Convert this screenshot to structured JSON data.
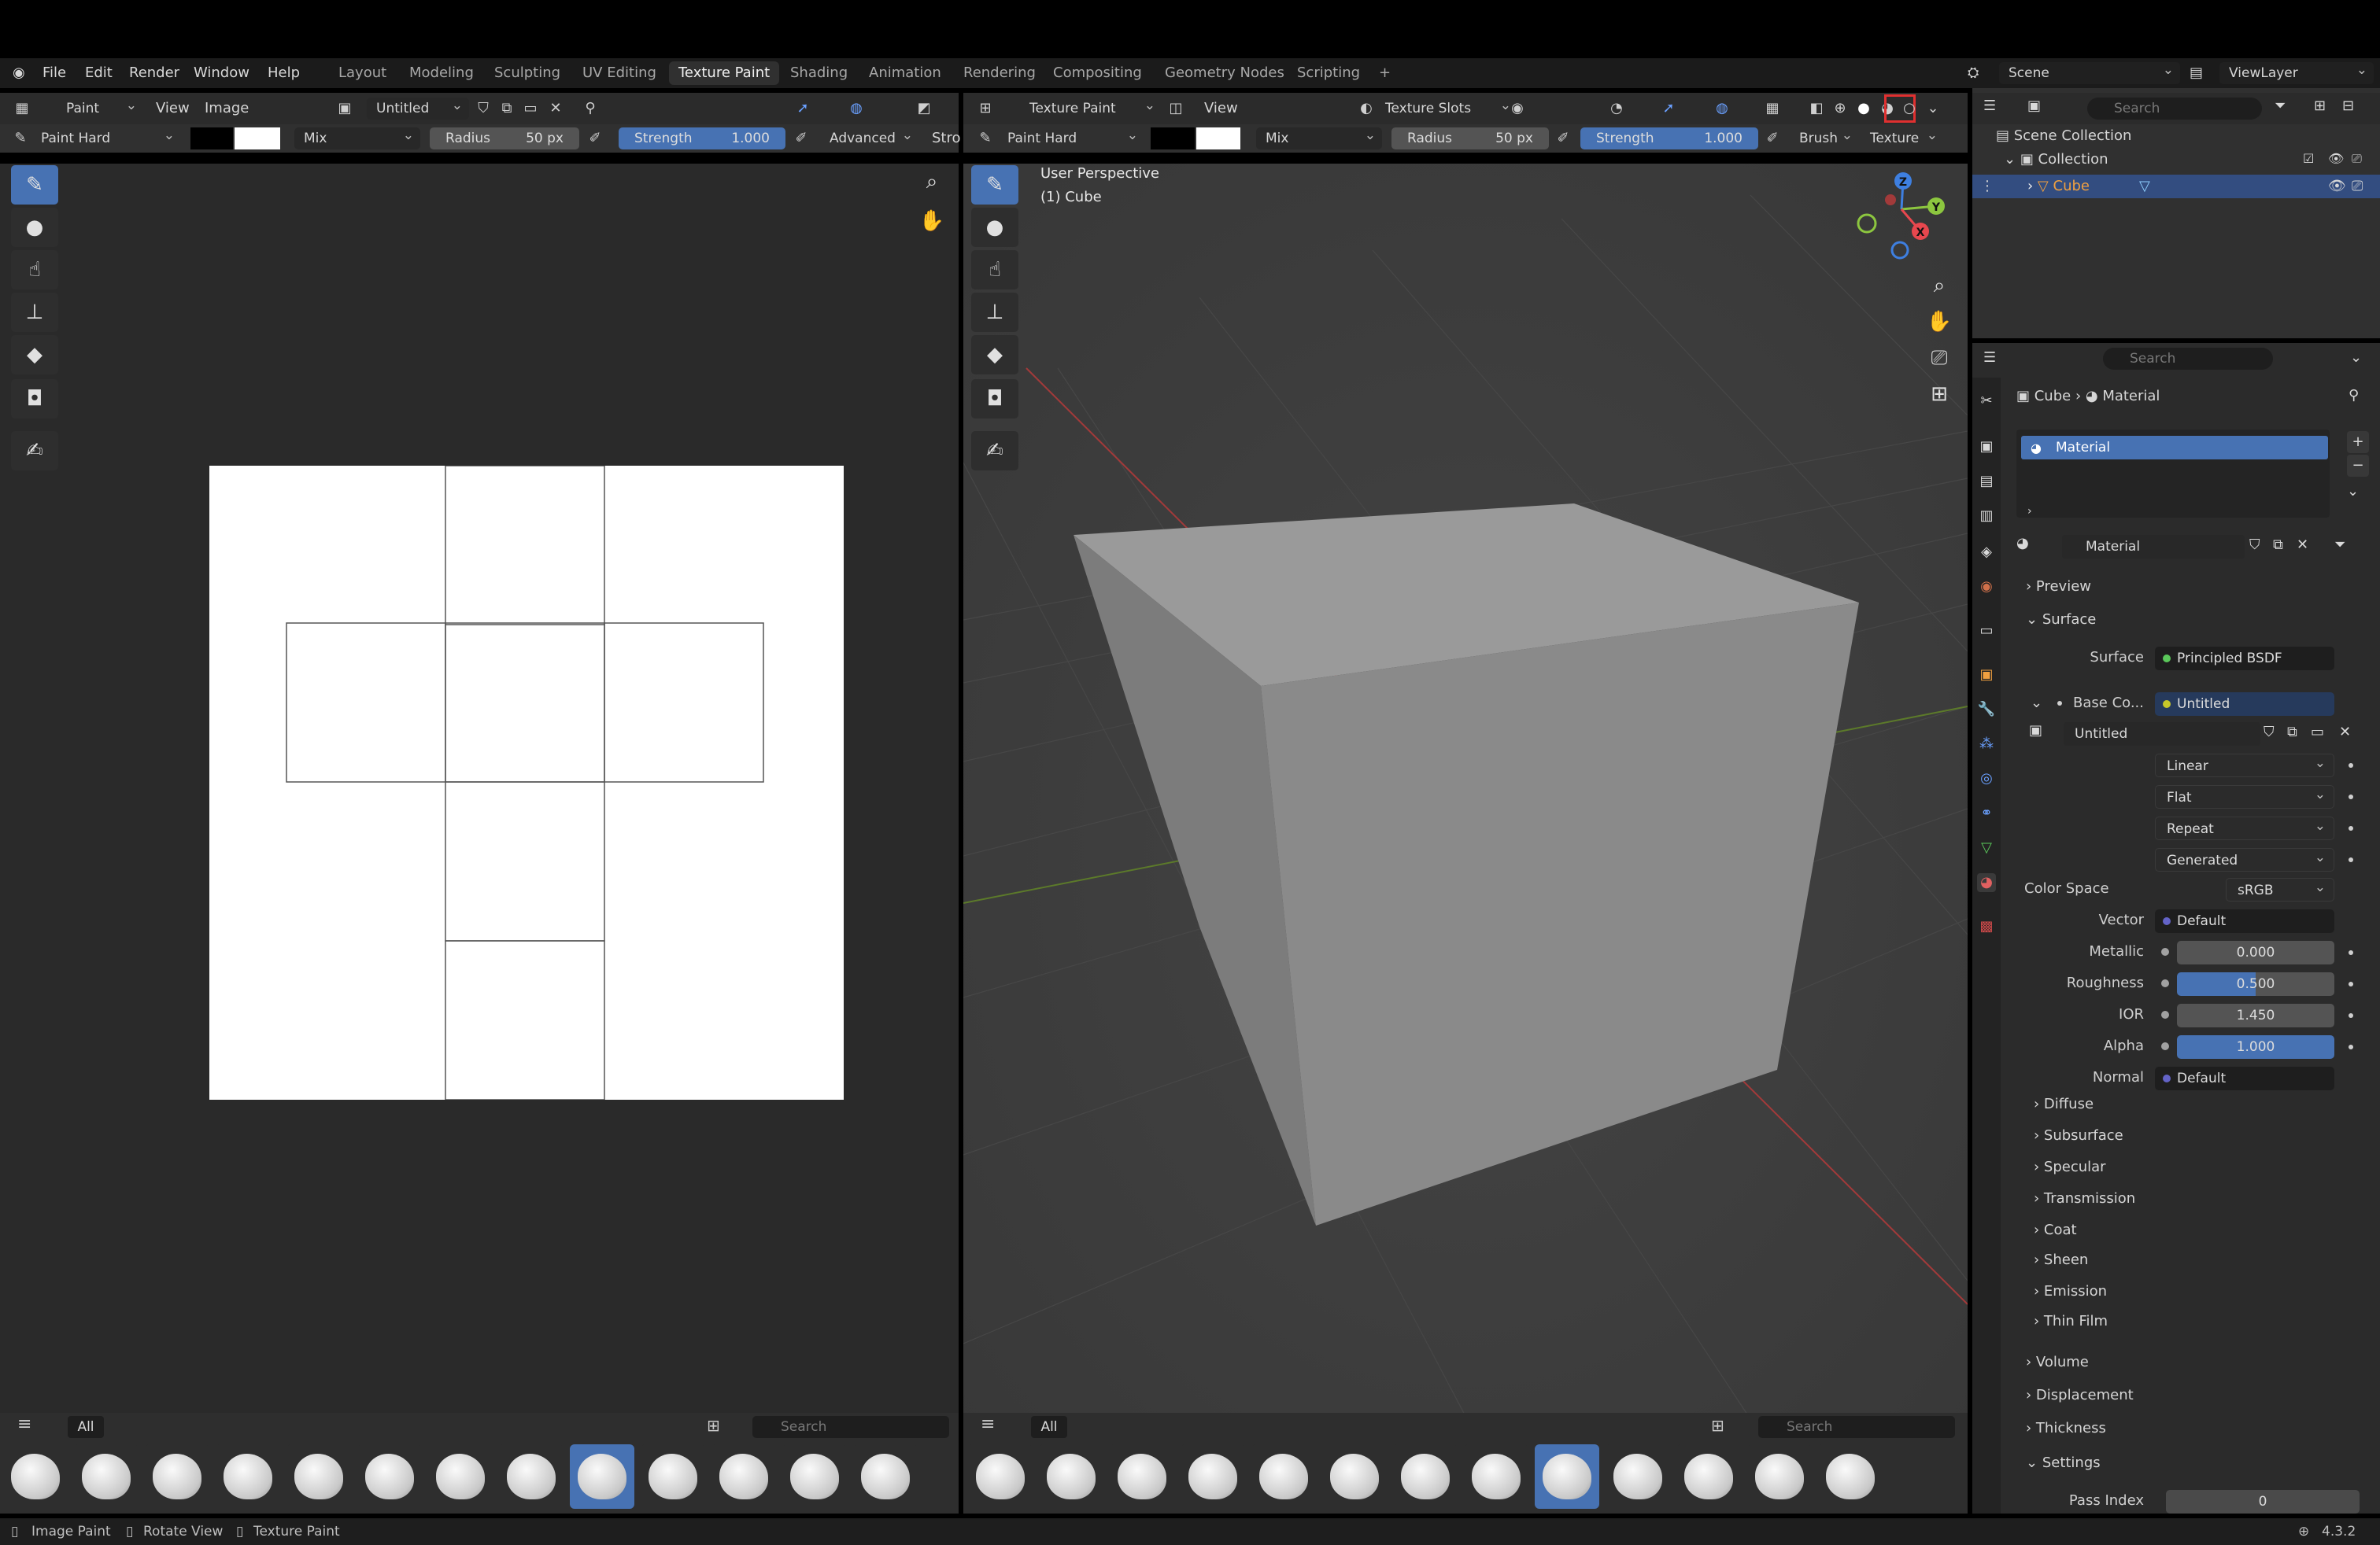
{
  "menubar": {
    "items": [
      "File",
      "Edit",
      "Render",
      "Window",
      "Help"
    ],
    "workspaces": [
      "Layout",
      "Modeling",
      "Sculpting",
      "UV Editing",
      "Texture Paint",
      "Shading",
      "Animation",
      "Rendering",
      "Compositing",
      "Geometry Nodes",
      "Scripting"
    ],
    "active_workspace": "Texture Paint",
    "add_tab": "+",
    "scene": "Scene",
    "view_layer": "ViewLayer"
  },
  "image_editor": {
    "mode": "Paint",
    "view_menu": "View",
    "image_menu": "Image",
    "image_name": "Untitled",
    "brush": "Paint Hard",
    "blend": "Mix",
    "radius_label": "Radius",
    "radius_value": "50 px",
    "strength_label": "Strength",
    "strength_value": "1.000",
    "advanced": "Advanced",
    "stroke": "Stro"
  },
  "viewport": {
    "mode": "Texture Paint",
    "view_menu": "View",
    "texture_slots": "Texture Slots",
    "brush": "Paint Hard",
    "blend": "Mix",
    "radius_label": "Radius",
    "radius_value": "50 px",
    "strength_label": "Strength",
    "strength_value": "1.000",
    "brush_menu": "Brush",
    "texture_menu": "Texture",
    "overlay_line1": "User Perspective",
    "overlay_line2": "(1) Cube",
    "gizmo_axes": [
      "X",
      "Y",
      "Z"
    ]
  },
  "asset_shelf": {
    "filter": "All",
    "search_placeholder": "Search"
  },
  "outliner": {
    "search_placeholder": "Search",
    "scene_collection": "Scene Collection",
    "collection": "Collection",
    "cube": "Cube"
  },
  "properties": {
    "search_placeholder": "Search",
    "breadcrumb_object": "Cube",
    "breadcrumb_material": "Material",
    "slot_material": "Material",
    "material_name": "Material",
    "preview": "Preview",
    "surface_panel": "Surface",
    "surface_label": "Surface",
    "surface_value": "Principled BSDF",
    "base_color_label": "Base Co...",
    "base_color_value": "Untitled",
    "image_name": "Untitled",
    "interpolation": "Linear",
    "projection": "Flat",
    "extension": "Repeat",
    "source": "Generated",
    "color_space_label": "Color Space",
    "color_space_value": "sRGB",
    "vector_label": "Vector",
    "vector_value": "Default",
    "metallic_label": "Metallic",
    "metallic_value": "0.000",
    "roughness_label": "Roughness",
    "roughness_value": "0.500",
    "ior_label": "IOR",
    "ior_value": "1.450",
    "alpha_label": "Alpha",
    "alpha_value": "1.000",
    "normal_label": "Normal",
    "normal_value": "Default",
    "subpanels": [
      "Diffuse",
      "Subsurface",
      "Specular",
      "Transmission",
      "Coat",
      "Sheen",
      "Emission",
      "Thin Film"
    ],
    "volume": "Volume",
    "displacement": "Displacement",
    "thickness": "Thickness",
    "settings": "Settings",
    "pass_index_label": "Pass Index",
    "pass_index_value": "0"
  },
  "statusbar": {
    "hint1": "Image Paint",
    "hint2": "Rotate View",
    "hint3": "Texture Paint",
    "version": "4.3.2"
  },
  "colors": {
    "accent": "#4772b3",
    "highlight_box": "#e03030",
    "axis_x": "#e8474e",
    "axis_y": "#8cc63f",
    "axis_z": "#3e7fe0"
  }
}
